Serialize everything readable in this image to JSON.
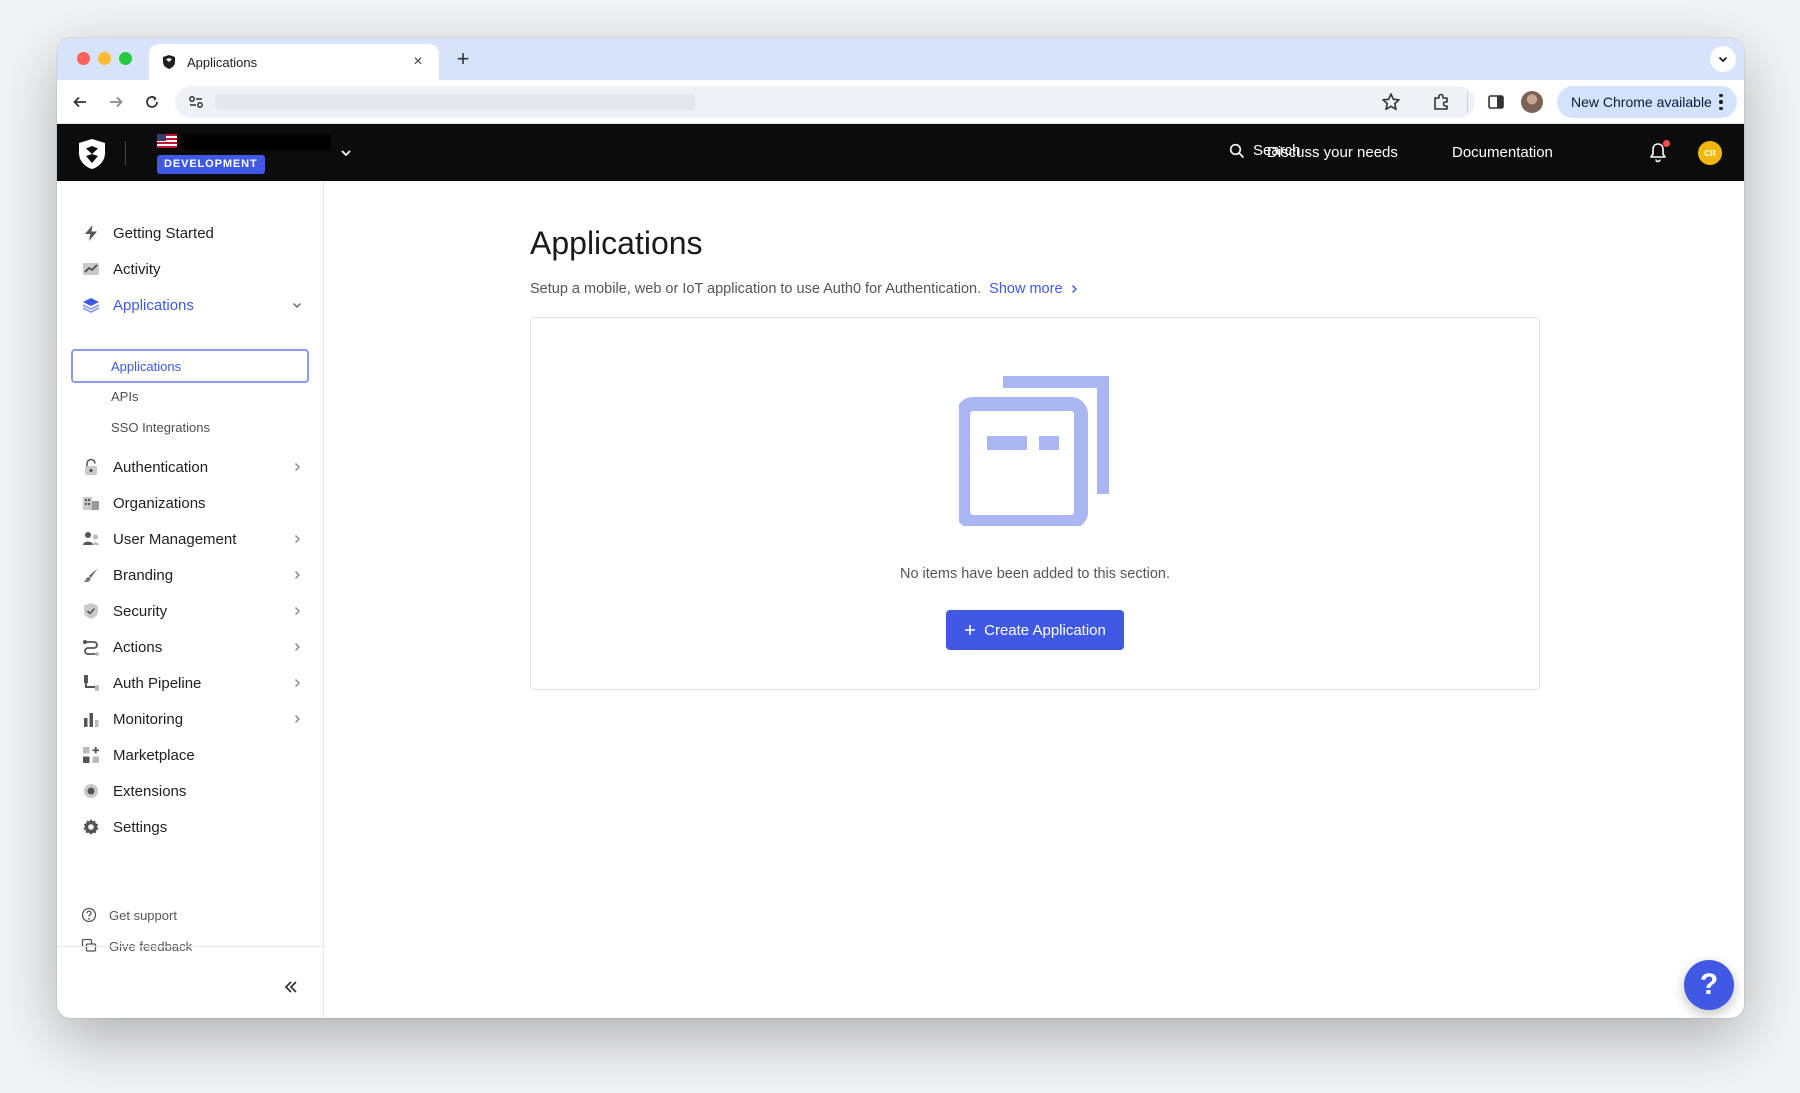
{
  "browser": {
    "tab_title": "Applications",
    "new_tab_symbol": "+",
    "close_symbol": "×",
    "update_label": "New Chrome available"
  },
  "header": {
    "env_badge": "DEVELOPMENT",
    "search_label": "Search",
    "discuss_label": "Discuss your needs",
    "docs_label": "Documentation",
    "avatar_initials": "CR"
  },
  "sidebar": {
    "items": [
      {
        "label": "Getting Started",
        "icon": "lightning-icon"
      },
      {
        "label": "Activity",
        "icon": "chart-line-icon"
      },
      {
        "label": "Applications",
        "icon": "layers-icon"
      },
      {
        "label": "Authentication",
        "icon": "lock-icon"
      },
      {
        "label": "Organizations",
        "icon": "building-icon"
      },
      {
        "label": "User Management",
        "icon": "users-icon"
      },
      {
        "label": "Branding",
        "icon": "brush-icon"
      },
      {
        "label": "Security",
        "icon": "shield-icon"
      },
      {
        "label": "Actions",
        "icon": "flow-icon"
      },
      {
        "label": "Auth Pipeline",
        "icon": "pipeline-icon"
      },
      {
        "label": "Monitoring",
        "icon": "bar-chart-icon"
      },
      {
        "label": "Marketplace",
        "icon": "grid-plus-icon"
      },
      {
        "label": "Extensions",
        "icon": "puzzle-icon"
      },
      {
        "label": "Settings",
        "icon": "gear-icon"
      }
    ],
    "sub_items": [
      "Applications",
      "APIs",
      "SSO Integrations"
    ],
    "footer": {
      "support_label": "Get support",
      "feedback_label": "Give feedback"
    }
  },
  "main": {
    "title": "Applications",
    "description": "Setup a mobile, web or IoT application to use Auth0 for Authentication.",
    "show_more": "Show more",
    "empty_text": "No items have been added to this section.",
    "create_button": "Create Application",
    "help_symbol": "?"
  },
  "colors": {
    "accent": "#3f59e4",
    "header_bg": "#0c0c0c",
    "illustration": "#a9b6f2"
  }
}
